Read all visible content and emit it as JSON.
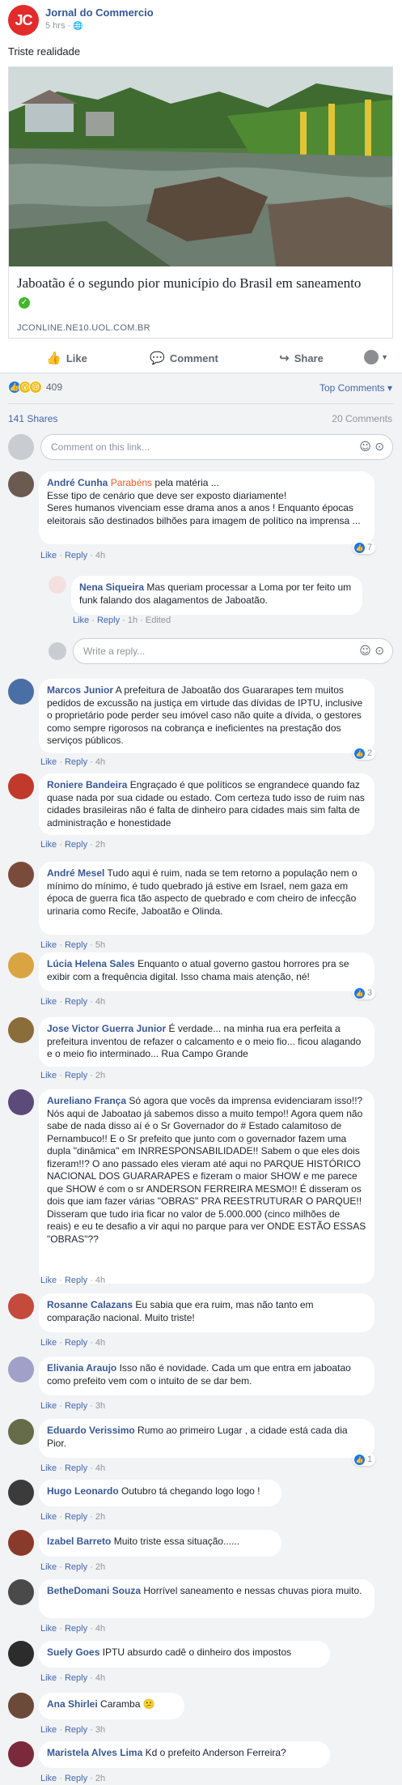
{
  "post": {
    "page_logo": "JC",
    "page_name": "Jornal do Commercio",
    "time": "5 hrs · ",
    "globe_icon": "globe-icon",
    "text": "Triste realidade",
    "link_title": "Jaboatão é o segundo pior município do Brasil em saneamento",
    "link_domain": "JCONLINE.NE10.UOL.COM.BR"
  },
  "actions": {
    "like": "Like",
    "comment": "Comment",
    "share": "Share"
  },
  "stats": {
    "reaction_count": "409",
    "top_comments": "Top Comments ▾",
    "shares": "141 Shares",
    "comments": "20 Comments"
  },
  "composer": {
    "placeholder": "Comment on this link..."
  },
  "reply_composer": {
    "placeholder": "Write a reply..."
  },
  "meta": {
    "like": "Like",
    "reply": "Reply",
    "dot": "·"
  },
  "comments": [
    {
      "author": "André Cunha",
      "extra": "Parabéns",
      "text": "pela matéria ...\nEsse tipo de cenário que deve ser exposto diariamente!\nSeres humanos vivenciam esse drama anos a anos ! Enquanto épocas eleitorais são destinados bilhões para imagem de político na imprensa ...",
      "time": "4h",
      "likes": "7"
    },
    {
      "author": "Nena Siqueira",
      "text": "Mas queriam processar a Loma por ter feito um funk falando dos alagamentos de Jaboatão.",
      "time": "1h",
      "edited": "Edited"
    },
    {
      "author": "Marcos Junior",
      "text": "A prefeitura de Jaboatão dos Guararapes tem muitos pedidos de excussão na justiça em virtude das dívidas de IPTU, inclusive o proprietário pode perder seu imóvel caso não quite a dívida, o gestores como sempre rigorosos na cobrança e ineficientes na prestação dos serviços públicos.",
      "time": "4h",
      "likes": "2"
    },
    {
      "author": "Roniere Bandeira",
      "text": "Engraçado é que políticos se engrandece quando faz quase nada por sua cidade ou estado. Com certeza tudo isso de ruim nas cidades brasileiras não é falta de dinheiro para cidades mais sim falta de administração e honestidade",
      "time": "2h"
    },
    {
      "author": "André Mesel",
      "text": "Tudo aqui é ruim, nada se tem retorno a população nem o mínimo do mínimo, é tudo quebrado já estive em Israel, nem gaza em época de guerra fica tão aspecto de quebrado e com cheiro de infecção urinaria como Recife, Jaboatão e Olinda.",
      "time": "5h"
    },
    {
      "author": "Lúcia Helena Sales",
      "text": "Enquanto o atual governo gastou horrores pra se exibir com a frequência digital. Isso chama mais atenção, né!",
      "time": "4h",
      "likes": "3"
    },
    {
      "author": "Jose Victor Guerra Junior",
      "text": "É verdade... na minha rua era perfeita a prefeitura inventou de refazer o calcamento e o meio fio... ficou alagando e o meio fio interminado... Rua Campo Grande",
      "time": "2h"
    },
    {
      "author": "Aureliano França",
      "text": "Só agora que vocês da imprensa evidenciaram isso!!? Nós aqui de Jaboatao já sabemos disso a muito tempo!! Agora quem não sabe de nada disso aí é o Sr Governador do # Estado calamitoso de Pernambuco!! E o Sr prefeito que junto com o governador fazem uma dupla \"dinâmica\" em INRRESPONSABILIDADE!! Sabem o que eles dois fizeram!!? O ano passado eles vieram até aqui no PARQUE HISTÓRICO NACIONAL DOS GUARARAPES e fizeram o maior SHOW e me parece que SHOW é com o sr ANDERSON FERREIRA MESMO!! É disseram os dois que iam fazer várias \"OBRAS\" PRA REESTRUTURAR O PARQUE!! Disseram que tudo iria ficar no valor de 5.000.000 (cinco milhões de reais) e eu te desafio a vir aqui no parque para ver ONDE ESTÃO ESSAS \"OBRAS\"??",
      "time": "4h"
    },
    {
      "author": "Rosanne Calazans",
      "text": "Eu sabia que era ruim, mas não tanto em comparação nacional. Muito triste!",
      "time": "4h"
    },
    {
      "author": "Elivania Araujo",
      "text": "Isso não é novidade. Cada um que entra em jaboatao como prefeito vem com o intuito de se dar bem.",
      "time": "3h"
    },
    {
      "author": "Eduardo Verissimo",
      "text": "Rumo ao primeiro Lugar , a cidade está cada dia Pior.",
      "time": "4h",
      "likes": "1"
    },
    {
      "author": "Hugo Leonardo",
      "text": "Outubro tá chegando logo logo !",
      "time": "2h"
    },
    {
      "author": "Izabel Barreto",
      "text": "Muito triste essa situação......",
      "time": "2h"
    },
    {
      "author": "BetheDomani Souza",
      "text": "Horrível saneamento e nessas chuvas piora muito.",
      "time": "4h"
    },
    {
      "author": "Suely Goes",
      "text": "IPTU absurdo cadê o dinheiro dos impostos",
      "time": "4h"
    },
    {
      "author": "Ana Shirlei",
      "text": "Caramba 😕",
      "time": "3h"
    },
    {
      "author": "Maristela Alves Lima",
      "text": "Kd o prefeito Anderson Ferreira?",
      "time": "2h"
    }
  ],
  "colors": {
    "author": "#385898",
    "link": "#4267b2",
    "accent_red": "#e32b2b",
    "extra_red": "#f05a28"
  }
}
